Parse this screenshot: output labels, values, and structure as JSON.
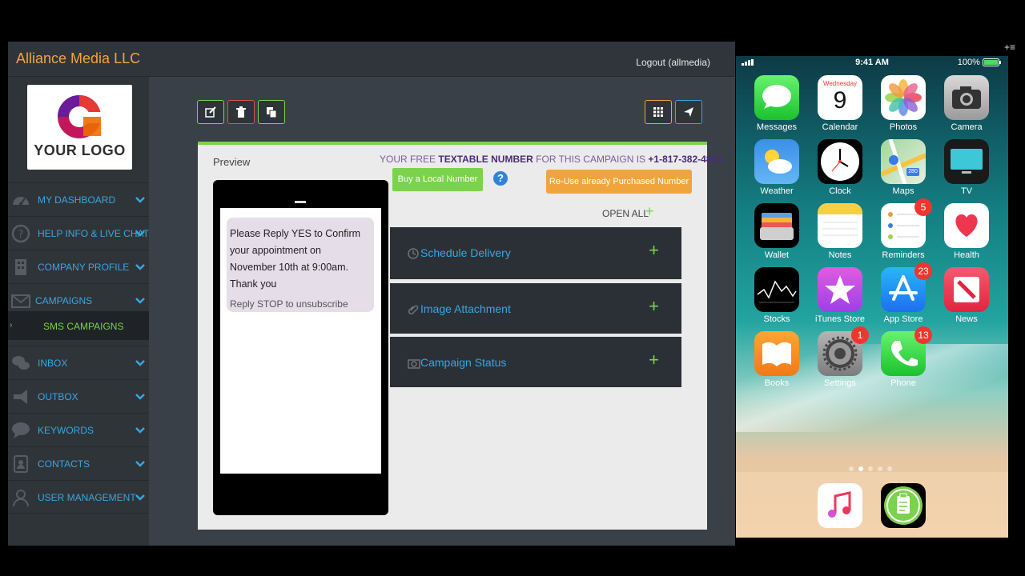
{
  "app": {
    "brand": "Alliance Media LLC",
    "logout": "Logout (allmedia)",
    "logo_text": "YOUR LOGO",
    "colors": {
      "accent_green": "#7bd24c",
      "accent_orange": "#f0a53c",
      "link_blue": "#39a6e0"
    }
  },
  "sidebar": {
    "items": [
      {
        "label": "MY DASHBOARD",
        "icon": "dashboard-icon"
      },
      {
        "label": "HELP INFO & LIVE CHAT",
        "icon": "help-circle-icon"
      },
      {
        "label": "COMPANY PROFILE",
        "icon": "building-icon"
      },
      {
        "label": "CAMPAIGNS",
        "icon": "envelope-icon"
      },
      {
        "label": "INBOX",
        "icon": "chat-bubbles-icon"
      },
      {
        "label": "OUTBOX",
        "icon": "megaphone-icon"
      },
      {
        "label": "KEYWORDS",
        "icon": "speech-icon"
      },
      {
        "label": "CONTACTS",
        "icon": "contact-card-icon"
      },
      {
        "label": "USER MANAGEMENT",
        "icon": "user-icon"
      }
    ],
    "sub_item": {
      "arrow": "›",
      "label": "SMS CAMPAIGNS"
    }
  },
  "toolbar": {
    "left": [
      "edit-icon",
      "trash-icon",
      "copy-icon"
    ],
    "right": [
      "grid-icon",
      "send-icon"
    ]
  },
  "panel": {
    "preview_label": "Preview",
    "free_prefix": "YOUR FREE",
    "free_bold": "TEXTABLE NUMBER",
    "free_middle": "FOR THIS CAMPAIGN IS",
    "phone_number": "+1-817-382-4874",
    "buy_button": "Buy a Local Number",
    "help": "?",
    "reuse_button": "Re-Use already Purchased Number",
    "open_all": "OPEN ALL",
    "plus": "+",
    "message": "Please Reply YES to Confirm your appointment on November 10th at 9:00am. Thank you",
    "stop_text": "Reply STOP to unsubscribe",
    "accordions": [
      {
        "title": "Schedule Delivery",
        "icon": "clock-icon"
      },
      {
        "title": "Image Attachment",
        "icon": "paperclip-icon"
      },
      {
        "title": "Campaign Status",
        "icon": "camera-icon"
      }
    ]
  },
  "ios": {
    "time": "9:41 AM",
    "battery": "100%",
    "apps": [
      {
        "label": "Messages",
        "badge": ""
      },
      {
        "label": "Calendar",
        "badge": "",
        "day_name": "Wednesday",
        "day": "9"
      },
      {
        "label": "Photos",
        "badge": ""
      },
      {
        "label": "Camera",
        "badge": ""
      },
      {
        "label": "Weather",
        "badge": ""
      },
      {
        "label": "Clock",
        "badge": ""
      },
      {
        "label": "Maps",
        "badge": "",
        "road": "280"
      },
      {
        "label": "TV",
        "badge": ""
      },
      {
        "label": "Wallet",
        "badge": ""
      },
      {
        "label": "Notes",
        "badge": ""
      },
      {
        "label": "Reminders",
        "badge": "5"
      },
      {
        "label": "Health",
        "badge": ""
      },
      {
        "label": "Stocks",
        "badge": ""
      },
      {
        "label": "iTunes Store",
        "badge": ""
      },
      {
        "label": "App Store",
        "badge": "23"
      },
      {
        "label": "News",
        "badge": ""
      },
      {
        "label": "Books",
        "badge": ""
      },
      {
        "label": "Settings",
        "badge": "1"
      },
      {
        "label": "Phone",
        "badge": "13"
      }
    ],
    "dock": [
      "music-icon",
      "clipboard-app-icon"
    ]
  }
}
